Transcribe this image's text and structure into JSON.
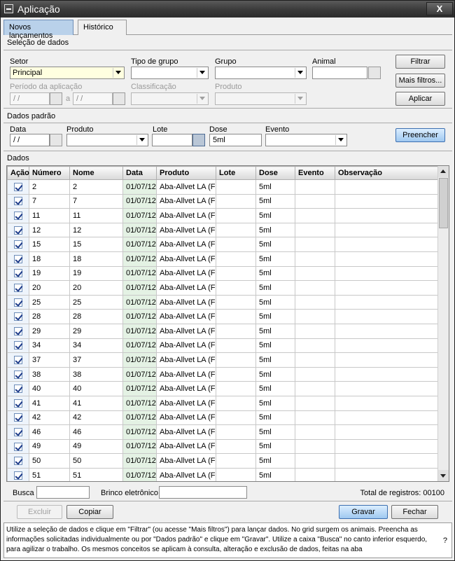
{
  "window": {
    "title": "Aplicação",
    "close_label": "X"
  },
  "tabs": [
    {
      "label": "Novos lançamentos"
    },
    {
      "label": "Histórico"
    }
  ],
  "selection": {
    "heading": "Seleção de dados",
    "setor_label": "Setor",
    "setor_value": "Principal",
    "tipo_grupo_label": "Tipo de grupo",
    "grupo_label": "Grupo",
    "animal_label": "Animal",
    "periodo_label": "Período da aplicação",
    "periodo_start": " / /",
    "periodo_sep": "a",
    "periodo_end": " / /",
    "classificacao_label": "Classificação",
    "produto_label": "Produto",
    "filtrar_label": "Filtrar",
    "mais_filtros_label": "Mais filtros...",
    "aplicar_label": "Aplicar"
  },
  "defaults": {
    "heading": "Dados padrão",
    "data_label": "Data",
    "data_value": " / /",
    "produto_label": "Produto",
    "lote_label": "Lote",
    "dose_label": "Dose",
    "dose_value": "5ml",
    "evento_label": "Evento",
    "preencher_label": "Preencher"
  },
  "grid": {
    "heading": "Dados",
    "columns": [
      "Ação",
      "Número",
      "Nome",
      "Data",
      "Produto",
      "Lote",
      "Dose",
      "Evento",
      "Observação"
    ],
    "rows": [
      {
        "numero": "2",
        "nome": "2",
        "data": "01/07/12",
        "produto": "Aba-Allvet LA (Fr",
        "lote": "",
        "dose": "5ml",
        "evento": "",
        "obs": ""
      },
      {
        "numero": "7",
        "nome": "7",
        "data": "01/07/12",
        "produto": "Aba-Allvet LA (Fr",
        "lote": "",
        "dose": "5ml",
        "evento": "",
        "obs": ""
      },
      {
        "numero": "11",
        "nome": "11",
        "data": "01/07/12",
        "produto": "Aba-Allvet LA (Fr",
        "lote": "",
        "dose": "5ml",
        "evento": "",
        "obs": ""
      },
      {
        "numero": "12",
        "nome": "12",
        "data": "01/07/12",
        "produto": "Aba-Allvet LA (Fr",
        "lote": "",
        "dose": "5ml",
        "evento": "",
        "obs": ""
      },
      {
        "numero": "15",
        "nome": "15",
        "data": "01/07/12",
        "produto": "Aba-Allvet LA (Fr",
        "lote": "",
        "dose": "5ml",
        "evento": "",
        "obs": ""
      },
      {
        "numero": "18",
        "nome": "18",
        "data": "01/07/12",
        "produto": "Aba-Allvet LA (Fr",
        "lote": "",
        "dose": "5ml",
        "evento": "",
        "obs": ""
      },
      {
        "numero": "19",
        "nome": "19",
        "data": "01/07/12",
        "produto": "Aba-Allvet LA (Fr",
        "lote": "",
        "dose": "5ml",
        "evento": "",
        "obs": ""
      },
      {
        "numero": "20",
        "nome": "20",
        "data": "01/07/12",
        "produto": "Aba-Allvet LA (Fr",
        "lote": "",
        "dose": "5ml",
        "evento": "",
        "obs": ""
      },
      {
        "numero": "25",
        "nome": "25",
        "data": "01/07/12",
        "produto": "Aba-Allvet LA (Fr",
        "lote": "",
        "dose": "5ml",
        "evento": "",
        "obs": ""
      },
      {
        "numero": "28",
        "nome": "28",
        "data": "01/07/12",
        "produto": "Aba-Allvet LA (Fr",
        "lote": "",
        "dose": "5ml",
        "evento": "",
        "obs": ""
      },
      {
        "numero": "29",
        "nome": "29",
        "data": "01/07/12",
        "produto": "Aba-Allvet LA (Fr",
        "lote": "",
        "dose": "5ml",
        "evento": "",
        "obs": ""
      },
      {
        "numero": "34",
        "nome": "34",
        "data": "01/07/12",
        "produto": "Aba-Allvet LA (Fr",
        "lote": "",
        "dose": "5ml",
        "evento": "",
        "obs": ""
      },
      {
        "numero": "37",
        "nome": "37",
        "data": "01/07/12",
        "produto": "Aba-Allvet LA (Fr",
        "lote": "",
        "dose": "5ml",
        "evento": "",
        "obs": ""
      },
      {
        "numero": "38",
        "nome": "38",
        "data": "01/07/12",
        "produto": "Aba-Allvet LA (Fr",
        "lote": "",
        "dose": "5ml",
        "evento": "",
        "obs": ""
      },
      {
        "numero": "40",
        "nome": "40",
        "data": "01/07/12",
        "produto": "Aba-Allvet LA (Fr",
        "lote": "",
        "dose": "5ml",
        "evento": "",
        "obs": ""
      },
      {
        "numero": "41",
        "nome": "41",
        "data": "01/07/12",
        "produto": "Aba-Allvet LA (Fr",
        "lote": "",
        "dose": "5ml",
        "evento": "",
        "obs": ""
      },
      {
        "numero": "42",
        "nome": "42",
        "data": "01/07/12",
        "produto": "Aba-Allvet LA (Fr",
        "lote": "",
        "dose": "5ml",
        "evento": "",
        "obs": ""
      },
      {
        "numero": "46",
        "nome": "46",
        "data": "01/07/12",
        "produto": "Aba-Allvet LA (Fr",
        "lote": "",
        "dose": "5ml",
        "evento": "",
        "obs": ""
      },
      {
        "numero": "49",
        "nome": "49",
        "data": "01/07/12",
        "produto": "Aba-Allvet LA (Fr",
        "lote": "",
        "dose": "5ml",
        "evento": "",
        "obs": ""
      },
      {
        "numero": "50",
        "nome": "50",
        "data": "01/07/12",
        "produto": "Aba-Allvet LA (Fr",
        "lote": "",
        "dose": "5ml",
        "evento": "",
        "obs": ""
      },
      {
        "numero": "51",
        "nome": "51",
        "data": "01/07/12",
        "produto": "Aba-Allvet LA (Fr",
        "lote": "",
        "dose": "5ml",
        "evento": "",
        "obs": ""
      }
    ]
  },
  "bottom": {
    "busca_label": "Busca",
    "brinco_label": "Brinco eletrônico",
    "total_text": "Total de registros: 00100",
    "excluir_label": "Excluir",
    "copiar_label": "Copiar",
    "gravar_label": "Gravar",
    "fechar_label": "Fechar"
  },
  "info": {
    "text": "Utilize a seleção de dados e clique em \"Filtrar\" (ou acesse \"Mais filtros\") para lançar dados. No grid surgem os animais. Preencha as informações solicitadas individualmente ou por \"Dados padrão\" e clique em  \"Gravar\". Utilize a caixa \"Busca\" no canto inferior esquerdo, para agilizar o trabalho. Os mesmos conceitos se aplicam à consulta, alteração e exclusão de dados, feitas na aba",
    "help_label": "?"
  }
}
